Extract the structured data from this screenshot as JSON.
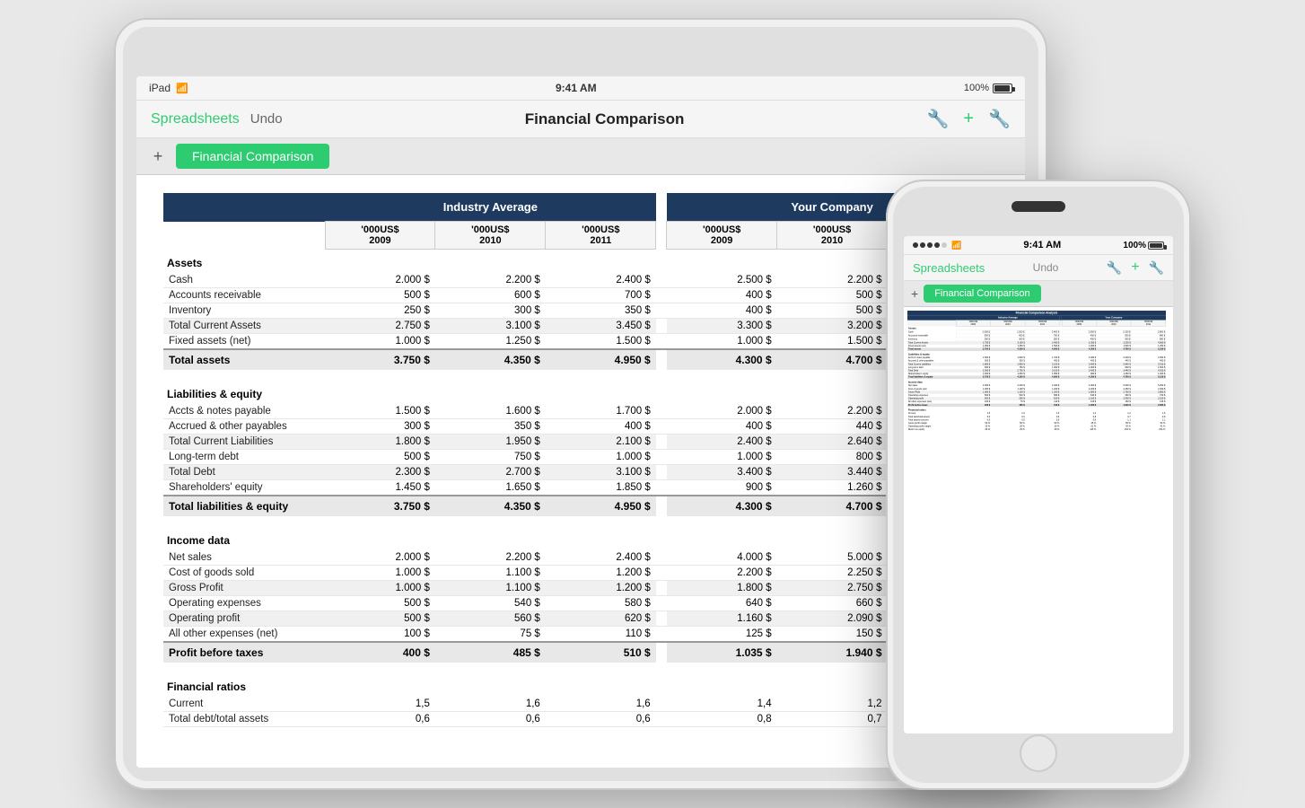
{
  "ipad": {
    "status": {
      "device": "iPad",
      "wifi": "WiFi",
      "time": "9:41 AM",
      "battery": "100%"
    },
    "nav": {
      "spreadsheets_label": "Spreadsheets",
      "undo_label": "Undo",
      "title": "Financial Comparison"
    },
    "tab": {
      "add_label": "+",
      "active_label": "Financial Comparison"
    }
  },
  "iphone": {
    "status": {
      "time": "9:41 AM",
      "battery": "100%"
    },
    "nav": {
      "spreadsheets_label": "Spreadsheets",
      "undo_label": "Undo"
    },
    "tab": {
      "active_label": "Financial Comparison"
    }
  },
  "spreadsheet": {
    "title": "Financial Comparison Analysis",
    "columns": {
      "industry_avg": "Industry Average",
      "your_company": "Your Company",
      "years": [
        "'000US$ 2009",
        "'000US$ 2010",
        "'000US$ 2011"
      ]
    },
    "sections": [
      {
        "name": "Assets",
        "rows": [
          {
            "label": "Cash",
            "ia": [
              "2.000 $",
              "2.200 $",
              "2.400 $"
            ],
            "yc": [
              "2.500 $",
              "2.200 $",
              "2.800 $"
            ]
          },
          {
            "label": "Accounts receivable",
            "ia": [
              "500 $",
              "600 $",
              "700 $"
            ],
            "yc": [
              "400 $",
              "500 $",
              "680 $"
            ]
          },
          {
            "label": "Inventory",
            "ia": [
              "250 $",
              "300 $",
              "350 $"
            ],
            "yc": [
              "400 $",
              "500 $",
              "580 $"
            ]
          },
          {
            "label": "Total Current Assets",
            "ia": [
              "2.750 $",
              "3.100 $",
              "3.450 $"
            ],
            "yc": [
              "3.300 $",
              "3.200 $",
              "4.060 $"
            ],
            "subtotal": true
          },
          {
            "label": "Fixed assets (net)",
            "ia": [
              "1.000 $",
              "1.250 $",
              "1.500 $"
            ],
            "yc": [
              "1.000 $",
              "1.500 $",
              "1.250 $"
            ]
          }
        ],
        "total": {
          "label": "Total assets",
          "ia": [
            "3.750 $",
            "4.350 $",
            "4.950 $"
          ],
          "yc": [
            "4.300 $",
            "4.700 $",
            "5.310 $"
          ]
        }
      },
      {
        "name": "Liabilities & equity",
        "rows": [
          {
            "label": "Accts & notes payable",
            "ia": [
              "1.500 $",
              "1.600 $",
              "1.700 $"
            ],
            "yc": [
              "2.000 $",
              "2.200 $",
              "2.050 $"
            ]
          },
          {
            "label": "Accrued & other payables",
            "ia": [
              "300 $",
              "350 $",
              "400 $"
            ],
            "yc": [
              "400 $",
              "440 $",
              "460 $"
            ]
          },
          {
            "label": "Total Current Liabilities",
            "ia": [
              "1.800 $",
              "1.950 $",
              "2.100 $"
            ],
            "yc": [
              "2.400 $",
              "2.640 $",
              "2.510 $"
            ],
            "subtotal": true
          },
          {
            "label": "Long-term debt",
            "ia": [
              "500 $",
              "750 $",
              "1.000 $"
            ],
            "yc": [
              "1.000 $",
              "800 $",
              "1.500 $"
            ]
          },
          {
            "label": "Total Debt",
            "ia": [
              "2.300 $",
              "2.700 $",
              "3.100 $"
            ],
            "yc": [
              "3.400 $",
              "3.440 $",
              "4.010 $"
            ],
            "subtotal": true
          },
          {
            "label": "Shareholders' equity",
            "ia": [
              "1.450 $",
              "1.650 $",
              "1.850 $"
            ],
            "yc": [
              "900 $",
              "1.260 $",
              "1.300 $"
            ]
          }
        ],
        "total": {
          "label": "Total liabilities & equity",
          "ia": [
            "3.750 $",
            "4.350 $",
            "4.950 $"
          ],
          "yc": [
            "4.300 $",
            "4.700 $",
            "5.310 $"
          ]
        }
      },
      {
        "name": "Income data",
        "rows": [
          {
            "label": "Net sales",
            "ia": [
              "2.000 $",
              "2.200 $",
              "2.400 $"
            ],
            "yc": [
              "4.000 $",
              "5.000 $",
              "5.250 $"
            ]
          },
          {
            "label": "Cost of goods sold",
            "ia": [
              "1.000 $",
              "1.100 $",
              "1.200 $"
            ],
            "yc": [
              "2.200 $",
              "2.250 $",
              "2.400 $"
            ]
          },
          {
            "label": "Gross Profit",
            "ia": [
              "1.000 $",
              "1.100 $",
              "1.200 $"
            ],
            "yc": [
              "1.800 $",
              "2.750 $",
              "2.850 $"
            ],
            "subtotal": true
          },
          {
            "label": "Operating expenses",
            "ia": [
              "500 $",
              "540 $",
              "580 $"
            ],
            "yc": [
              "640 $",
              "660 $",
              "700 $"
            ]
          },
          {
            "label": "Operating profit",
            "ia": [
              "500 $",
              "560 $",
              "620 $"
            ],
            "yc": [
              "1.160 $",
              "2.090 $",
              "2.150 $"
            ],
            "subtotal": true
          },
          {
            "label": "All other expenses (net)",
            "ia": [
              "100 $",
              "75 $",
              "110 $"
            ],
            "yc": [
              "125 $",
              "150 $",
              "145 $"
            ]
          }
        ],
        "total": {
          "label": "Profit before taxes",
          "ia": [
            "400 $",
            "485 $",
            "510 $"
          ],
          "yc": [
            "1.035 $",
            "1.940 $",
            "2.005 $"
          ]
        }
      },
      {
        "name": "Financial ratios",
        "rows": [
          {
            "label": "Current",
            "ia": [
              "1,5",
              "1,6",
              "1,6"
            ],
            "yc": [
              "1,4",
              "1,2",
              "1,6"
            ]
          },
          {
            "label": "Total debt/total assets",
            "ia": [
              "0,6",
              "0,6",
              "0,6"
            ],
            "yc": [
              "0,8",
              "0,7",
              "0,8"
            ]
          }
        ]
      }
    ]
  }
}
